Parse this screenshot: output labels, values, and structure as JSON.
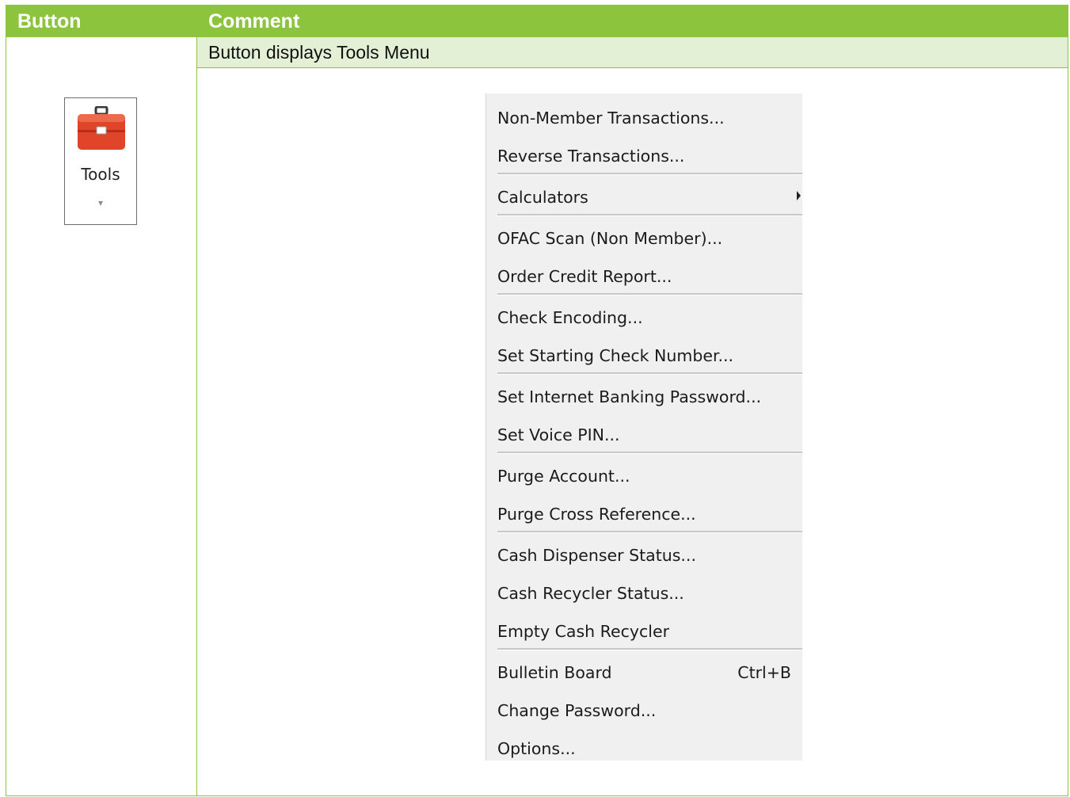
{
  "table": {
    "headers": [
      "Button",
      "Comment"
    ],
    "description": "Button displays Tools Menu"
  },
  "tools_button": {
    "label": "Tools",
    "icon": "toolbox-icon",
    "caret": "▾",
    "colors": {
      "icon_body": "#e0452a",
      "icon_shade": "#b62f18"
    }
  },
  "menu": {
    "items": [
      "Non-Member Transactions...",
      "Reverse Transactions...",
      "Calculators",
      "OFAC Scan (Non Member)...",
      "Order Credit Report...",
      "Check Encoding...",
      "Set Starting Check Number...",
      "Set Internet Banking Password...",
      "Set Voice PIN...",
      "Purge Account...",
      "Purge Cross Reference...",
      "Cash Dispenser Status...",
      "Cash Recycler Status...",
      "Empty Cash Recycler",
      "Bulletin Board",
      "Change Password...",
      "Options..."
    ],
    "bulletin_shortcut": "Ctrl+B"
  },
  "colors": {
    "header_green": "#8cc43e",
    "row_tint": "#e3f0d6",
    "menu_bg": "#f0f0f0"
  }
}
